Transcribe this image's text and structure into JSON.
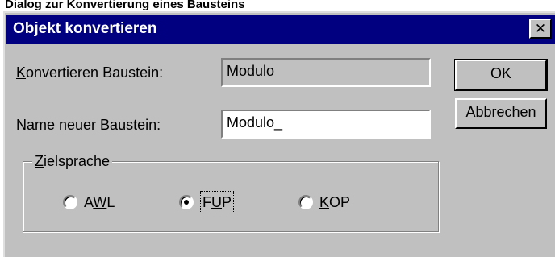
{
  "caption": "Dialog zur Konvertierung eines Bausteins",
  "window": {
    "title": "Objekt konvertieren",
    "close_glyph": "✕"
  },
  "fields": {
    "source": {
      "label_mnemonic": "K",
      "label_rest": "onvertieren Baustein:",
      "value": "Modulo"
    },
    "target": {
      "label_mnemonic": "N",
      "label_rest": "ame neuer Baustein:",
      "value": "Modulo_"
    }
  },
  "buttons": {
    "ok": "OK",
    "cancel": "Abbrechen"
  },
  "group": {
    "title_mnemonic": "Z",
    "title_rest": "ielsprache",
    "options": [
      {
        "pre": "A",
        "mnemonic": "W",
        "post": "L",
        "selected": false
      },
      {
        "pre": "F",
        "mnemonic": "U",
        "post": "P",
        "selected": true
      },
      {
        "pre": "",
        "mnemonic": "K",
        "post": "OP",
        "selected": false
      }
    ]
  }
}
